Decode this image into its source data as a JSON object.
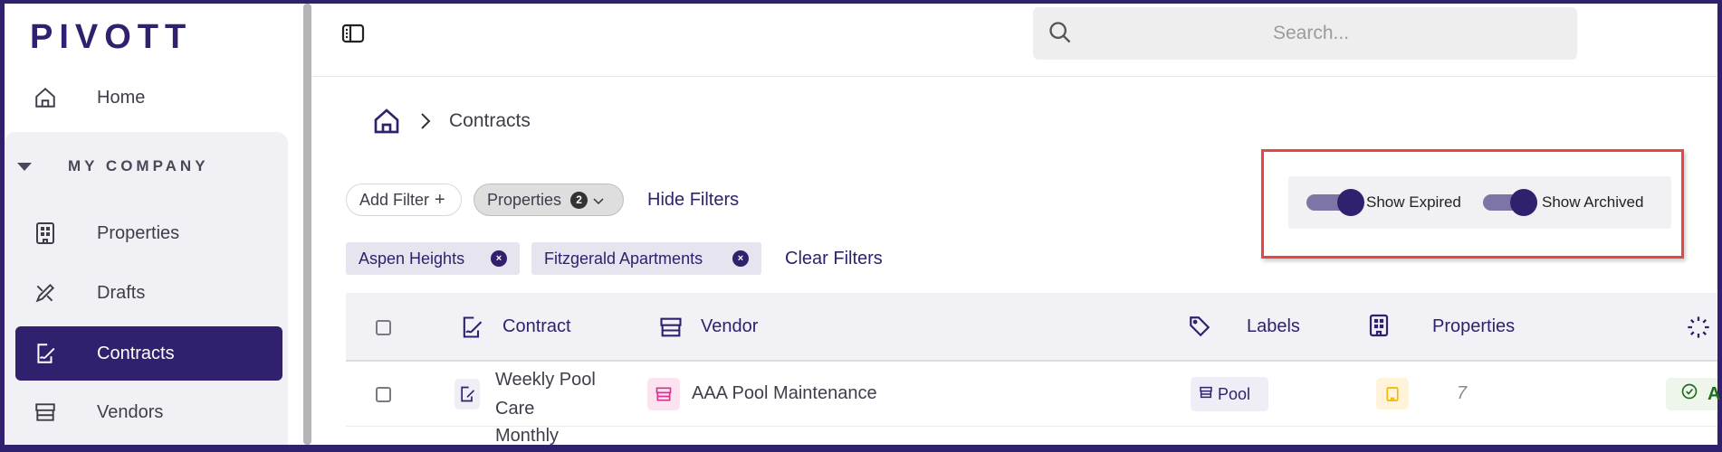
{
  "app": {
    "logo": "PIVOTT"
  },
  "sidebar": {
    "home": "Home",
    "section": "MY COMPANY",
    "items": [
      {
        "label": "Properties"
      },
      {
        "label": "Drafts"
      },
      {
        "label": "Contracts"
      },
      {
        "label": "Vendors"
      }
    ]
  },
  "header": {
    "search_placeholder": "Search..."
  },
  "breadcrumb": {
    "current": "Contracts"
  },
  "filters": {
    "add_filter": "Add Filter",
    "properties_filter": "Properties",
    "properties_count": "2",
    "hide_filters": "Hide Filters",
    "chips": [
      "Aspen Heights",
      "Fitzgerald Apartments"
    ],
    "clear_filters": "Clear Filters"
  },
  "toggles": {
    "show_expired": {
      "label": "Show Expired",
      "on": true
    },
    "show_archived": {
      "label": "Show Archived",
      "on": true
    }
  },
  "table": {
    "columns": [
      "Contract",
      "Vendor",
      "Labels",
      "Properties"
    ],
    "rows": [
      {
        "contract_line1": "Weekly Pool",
        "contract_line2": "Care",
        "vendor": "AAA Pool Maintenance",
        "label": "Pool",
        "properties": "7",
        "status": "A"
      },
      {
        "contract_line1": "Monthly"
      }
    ]
  },
  "colors": {
    "brand": "#31206e",
    "highlight": "#e84545"
  }
}
